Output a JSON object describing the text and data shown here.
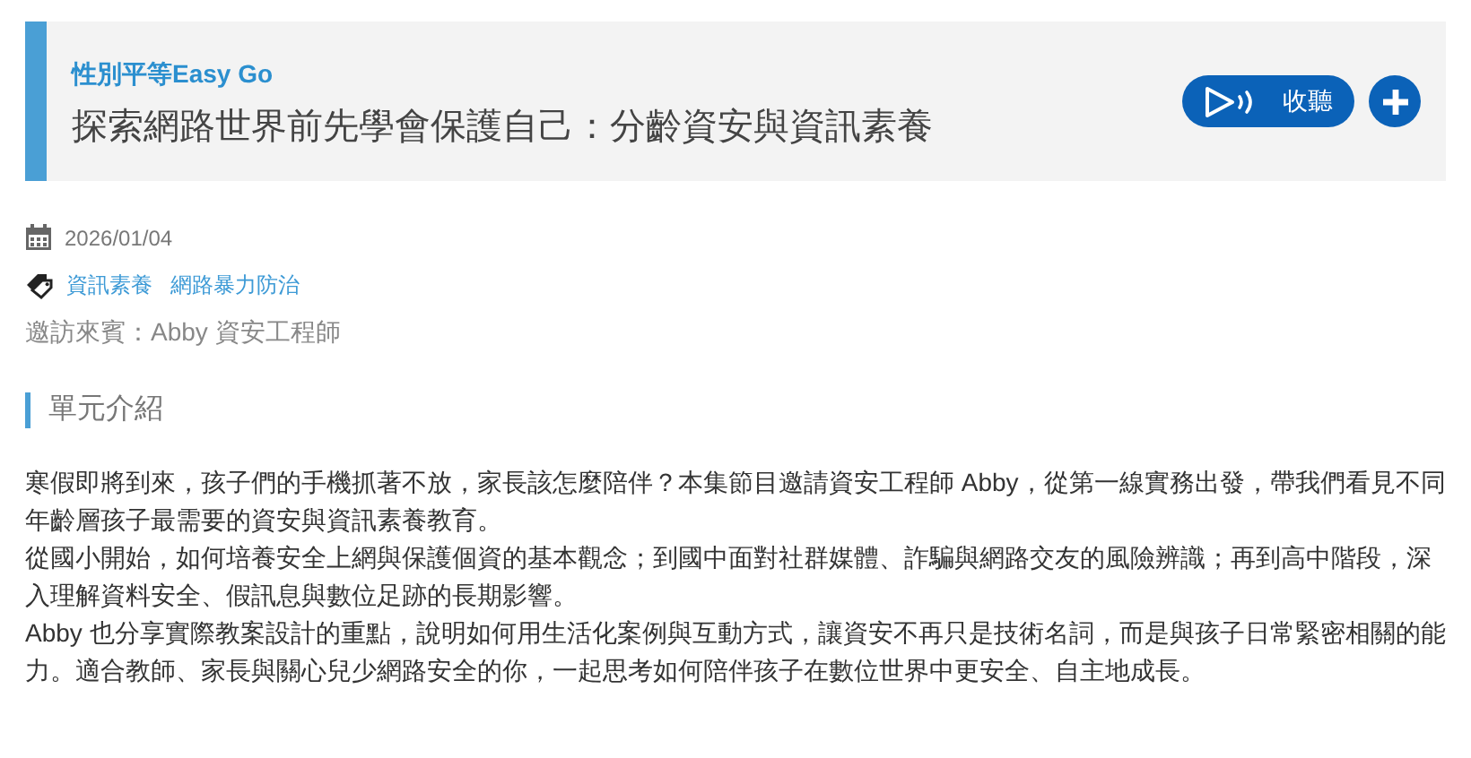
{
  "header": {
    "series": "性別平等Easy Go",
    "title": "探索網路世界前先學會保護自己：分齡資安與資訊素養",
    "listen_button": "收聽"
  },
  "meta": {
    "date": "2026/01/04",
    "tags": [
      "資訊素養",
      "網路暴力防治"
    ],
    "guest": "邀訪來賓：Abby 資安工程師"
  },
  "section": {
    "heading": "單元介紹",
    "paragraphs": [
      "寒假即將到來，孩子們的手機抓著不放，家長該怎麼陪伴？本集節目邀請資安工程師 Abby，從第一線實務出發，帶我們看見不同年齡層孩子最需要的資安與資訊素養教育。",
      "從國小開始，如何培養安全上網與保護個資的基本觀念；到國中面對社群媒體、詐騙與網路交友的風險辨識；再到高中階段，深入理解資料安全、假訊息與數位足跡的長期影響。",
      "Abby 也分享實際教案設計的重點，說明如何用生活化案例與互動方式，讓資安不再只是技術名詞，而是與孩子日常緊密相關的能力。適合教師、家長與關心兒少網路安全的你，一起思考如何陪伴孩子在數位世界中更安全、自主地成長。"
    ]
  }
}
